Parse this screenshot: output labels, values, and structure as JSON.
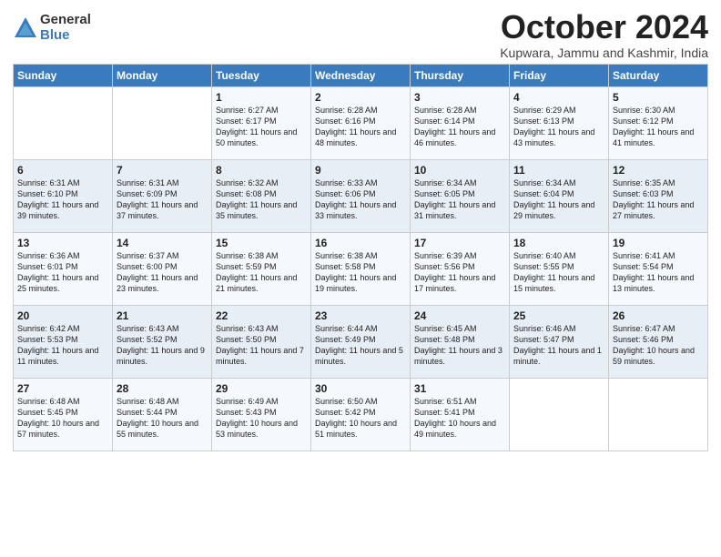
{
  "header": {
    "logo_general": "General",
    "logo_blue": "Blue",
    "title": "October 2024",
    "location": "Kupwara, Jammu and Kashmir, India"
  },
  "days_of_week": [
    "Sunday",
    "Monday",
    "Tuesday",
    "Wednesday",
    "Thursday",
    "Friday",
    "Saturday"
  ],
  "weeks": [
    [
      {
        "day": "",
        "sunrise": "",
        "sunset": "",
        "daylight": ""
      },
      {
        "day": "",
        "sunrise": "",
        "sunset": "",
        "daylight": ""
      },
      {
        "day": "1",
        "sunrise": "Sunrise: 6:27 AM",
        "sunset": "Sunset: 6:17 PM",
        "daylight": "Daylight: 11 hours and 50 minutes."
      },
      {
        "day": "2",
        "sunrise": "Sunrise: 6:28 AM",
        "sunset": "Sunset: 6:16 PM",
        "daylight": "Daylight: 11 hours and 48 minutes."
      },
      {
        "day": "3",
        "sunrise": "Sunrise: 6:28 AM",
        "sunset": "Sunset: 6:14 PM",
        "daylight": "Daylight: 11 hours and 46 minutes."
      },
      {
        "day": "4",
        "sunrise": "Sunrise: 6:29 AM",
        "sunset": "Sunset: 6:13 PM",
        "daylight": "Daylight: 11 hours and 43 minutes."
      },
      {
        "day": "5",
        "sunrise": "Sunrise: 6:30 AM",
        "sunset": "Sunset: 6:12 PM",
        "daylight": "Daylight: 11 hours and 41 minutes."
      }
    ],
    [
      {
        "day": "6",
        "sunrise": "Sunrise: 6:31 AM",
        "sunset": "Sunset: 6:10 PM",
        "daylight": "Daylight: 11 hours and 39 minutes."
      },
      {
        "day": "7",
        "sunrise": "Sunrise: 6:31 AM",
        "sunset": "Sunset: 6:09 PM",
        "daylight": "Daylight: 11 hours and 37 minutes."
      },
      {
        "day": "8",
        "sunrise": "Sunrise: 6:32 AM",
        "sunset": "Sunset: 6:08 PM",
        "daylight": "Daylight: 11 hours and 35 minutes."
      },
      {
        "day": "9",
        "sunrise": "Sunrise: 6:33 AM",
        "sunset": "Sunset: 6:06 PM",
        "daylight": "Daylight: 11 hours and 33 minutes."
      },
      {
        "day": "10",
        "sunrise": "Sunrise: 6:34 AM",
        "sunset": "Sunset: 6:05 PM",
        "daylight": "Daylight: 11 hours and 31 minutes."
      },
      {
        "day": "11",
        "sunrise": "Sunrise: 6:34 AM",
        "sunset": "Sunset: 6:04 PM",
        "daylight": "Daylight: 11 hours and 29 minutes."
      },
      {
        "day": "12",
        "sunrise": "Sunrise: 6:35 AM",
        "sunset": "Sunset: 6:03 PM",
        "daylight": "Daylight: 11 hours and 27 minutes."
      }
    ],
    [
      {
        "day": "13",
        "sunrise": "Sunrise: 6:36 AM",
        "sunset": "Sunset: 6:01 PM",
        "daylight": "Daylight: 11 hours and 25 minutes."
      },
      {
        "day": "14",
        "sunrise": "Sunrise: 6:37 AM",
        "sunset": "Sunset: 6:00 PM",
        "daylight": "Daylight: 11 hours and 23 minutes."
      },
      {
        "day": "15",
        "sunrise": "Sunrise: 6:38 AM",
        "sunset": "Sunset: 5:59 PM",
        "daylight": "Daylight: 11 hours and 21 minutes."
      },
      {
        "day": "16",
        "sunrise": "Sunrise: 6:38 AM",
        "sunset": "Sunset: 5:58 PM",
        "daylight": "Daylight: 11 hours and 19 minutes."
      },
      {
        "day": "17",
        "sunrise": "Sunrise: 6:39 AM",
        "sunset": "Sunset: 5:56 PM",
        "daylight": "Daylight: 11 hours and 17 minutes."
      },
      {
        "day": "18",
        "sunrise": "Sunrise: 6:40 AM",
        "sunset": "Sunset: 5:55 PM",
        "daylight": "Daylight: 11 hours and 15 minutes."
      },
      {
        "day": "19",
        "sunrise": "Sunrise: 6:41 AM",
        "sunset": "Sunset: 5:54 PM",
        "daylight": "Daylight: 11 hours and 13 minutes."
      }
    ],
    [
      {
        "day": "20",
        "sunrise": "Sunrise: 6:42 AM",
        "sunset": "Sunset: 5:53 PM",
        "daylight": "Daylight: 11 hours and 11 minutes."
      },
      {
        "day": "21",
        "sunrise": "Sunrise: 6:43 AM",
        "sunset": "Sunset: 5:52 PM",
        "daylight": "Daylight: 11 hours and 9 minutes."
      },
      {
        "day": "22",
        "sunrise": "Sunrise: 6:43 AM",
        "sunset": "Sunset: 5:50 PM",
        "daylight": "Daylight: 11 hours and 7 minutes."
      },
      {
        "day": "23",
        "sunrise": "Sunrise: 6:44 AM",
        "sunset": "Sunset: 5:49 PM",
        "daylight": "Daylight: 11 hours and 5 minutes."
      },
      {
        "day": "24",
        "sunrise": "Sunrise: 6:45 AM",
        "sunset": "Sunset: 5:48 PM",
        "daylight": "Daylight: 11 hours and 3 minutes."
      },
      {
        "day": "25",
        "sunrise": "Sunrise: 6:46 AM",
        "sunset": "Sunset: 5:47 PM",
        "daylight": "Daylight: 11 hours and 1 minute."
      },
      {
        "day": "26",
        "sunrise": "Sunrise: 6:47 AM",
        "sunset": "Sunset: 5:46 PM",
        "daylight": "Daylight: 10 hours and 59 minutes."
      }
    ],
    [
      {
        "day": "27",
        "sunrise": "Sunrise: 6:48 AM",
        "sunset": "Sunset: 5:45 PM",
        "daylight": "Daylight: 10 hours and 57 minutes."
      },
      {
        "day": "28",
        "sunrise": "Sunrise: 6:48 AM",
        "sunset": "Sunset: 5:44 PM",
        "daylight": "Daylight: 10 hours and 55 minutes."
      },
      {
        "day": "29",
        "sunrise": "Sunrise: 6:49 AM",
        "sunset": "Sunset: 5:43 PM",
        "daylight": "Daylight: 10 hours and 53 minutes."
      },
      {
        "day": "30",
        "sunrise": "Sunrise: 6:50 AM",
        "sunset": "Sunset: 5:42 PM",
        "daylight": "Daylight: 10 hours and 51 minutes."
      },
      {
        "day": "31",
        "sunrise": "Sunrise: 6:51 AM",
        "sunset": "Sunset: 5:41 PM",
        "daylight": "Daylight: 10 hours and 49 minutes."
      },
      {
        "day": "",
        "sunrise": "",
        "sunset": "",
        "daylight": ""
      },
      {
        "day": "",
        "sunrise": "",
        "sunset": "",
        "daylight": ""
      }
    ]
  ]
}
